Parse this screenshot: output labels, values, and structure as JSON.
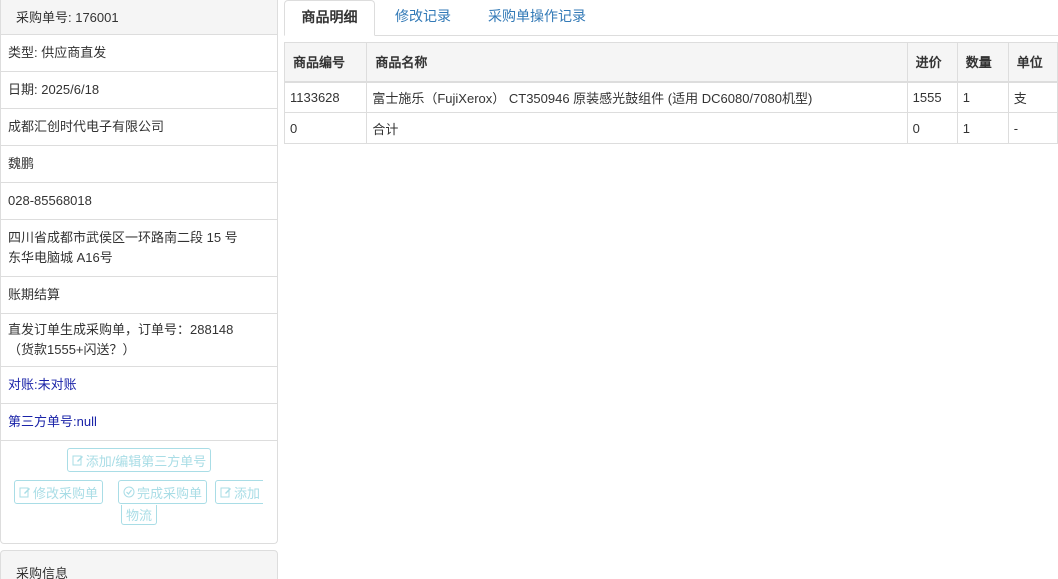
{
  "order": {
    "heading": "采购单号: 176001",
    "type": "类型: 供应商直发",
    "date": "日期: 2025/6/18",
    "supplier": "成都汇创时代电子有限公司",
    "contact": "魏鹏",
    "phone": "028-85568018",
    "address_line1": "四川省成都市武侯区一环路南二段 15 号",
    "address_line2": "东华电脑城 A16号",
    "payment": "账期结算",
    "remark_line1": "直发订单生成采购单，订单号：288148",
    "remark_line2": "（货款1555+闪送？）",
    "reconcile_label": "对账: ",
    "reconcile_value": "未对账",
    "third_party_label": "第三方单号: ",
    "third_party_value": "null"
  },
  "buttons": {
    "add_edit_third_party": "添加/编辑第三方单号",
    "modify": "修改采购单",
    "complete": "完成采购单",
    "add_logistics_a": "添加",
    "add_logistics_b": "物流"
  },
  "second_panel": {
    "heading": "采购信息"
  },
  "tabs": [
    {
      "label": "商品明细"
    },
    {
      "label": "修改记录"
    },
    {
      "label": "采购单操作记录"
    }
  ],
  "table": {
    "headers": [
      "商品编号",
      "商品名称",
      "进价",
      "数量",
      "单位"
    ],
    "rows": [
      [
        "1133628",
        "富士施乐（FujiXerox） CT350946 原装感光鼓组件 (适用 DC6080/7080机型)",
        "1555",
        "1",
        "支"
      ],
      [
        "0",
        "合计",
        "0",
        "1",
        "-"
      ]
    ]
  },
  "colors": {
    "link": "#337ab7",
    "dark_blue_text": "#1a23a8",
    "disabled_button": "#a9dde6",
    "border": "#dddddd",
    "header_bg": "#f5f5f5"
  },
  "icons": [
    "edit-icon",
    "check-circle-icon"
  ]
}
